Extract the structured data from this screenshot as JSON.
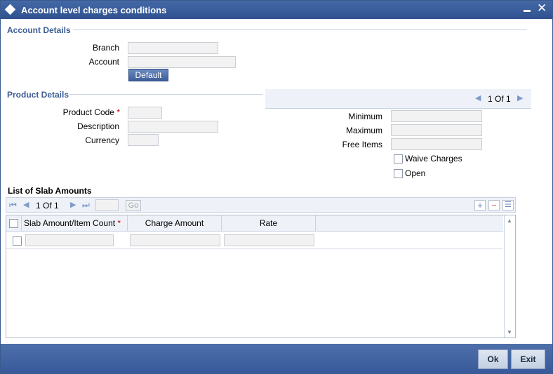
{
  "window": {
    "title": "Account level charges conditions"
  },
  "account_details": {
    "heading": "Account Details",
    "branch_label": "Branch",
    "branch_value": "",
    "account_label": "Account",
    "account_value": "",
    "default_button": "Default"
  },
  "product_details": {
    "heading": "Product Details",
    "product_code_label": "Product Code",
    "required_marker": "*",
    "product_code_value": "",
    "description_label": "Description",
    "description_value": "",
    "currency_label": "Currency",
    "currency_value": ""
  },
  "right_panel": {
    "pager_current": "1",
    "pager_of": "Of",
    "pager_total": "1",
    "minimum_label": "Minimum",
    "minimum_value": "",
    "maximum_label": "Maximum",
    "maximum_value": "",
    "free_items_label": "Free Items",
    "free_items_value": "",
    "waive_charges_label": "Waive Charges",
    "waive_charges_checked": false,
    "open_label": "Open",
    "open_checked": false
  },
  "slab_list": {
    "heading": "List of Slab Amounts",
    "pager_current": "1",
    "pager_of": "Of",
    "pager_total": "1",
    "go_label": "Go",
    "columns": [
      "Slab Amount/Item Count",
      "Charge Amount",
      "Rate"
    ],
    "required_marker": "*",
    "rows": [
      {
        "slab_amount": "",
        "charge_amount": "",
        "rate": ""
      }
    ]
  },
  "footer": {
    "ok_label": "Ok",
    "exit_label": "Exit"
  }
}
